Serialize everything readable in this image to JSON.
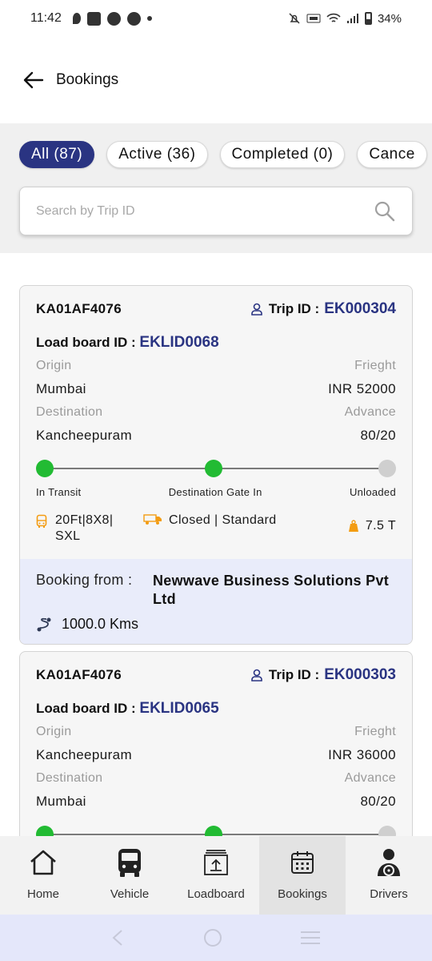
{
  "status_bar": {
    "time": "11:42",
    "battery": "34%"
  },
  "header": {
    "title": "Bookings"
  },
  "tabs": [
    {
      "label": "All (87)",
      "active": true
    },
    {
      "label": "Active (36)",
      "active": false
    },
    {
      "label": "Completed (0)",
      "active": false
    },
    {
      "label": "Cance",
      "active": false
    }
  ],
  "search": {
    "placeholder": "Search by Trip ID",
    "value": ""
  },
  "bookings": [
    {
      "vehicle_no": "KA01AF4076",
      "trip_label": "Trip ID :",
      "trip_id": "EK000304",
      "load_label": "Load board ID :",
      "load_id": "EKLID0068",
      "origin_label": "Origin",
      "origin": "Mumbai",
      "freight_label": "Frieght",
      "freight": "INR 52000",
      "destination_label": "Destination",
      "destination": "Kancheepuram",
      "advance_label": "Advance",
      "advance": "80/20",
      "steps": [
        "In Transit",
        "Destination Gate In",
        "Unloaded"
      ],
      "truck_size_1": "20Ft|8X8|",
      "truck_size_2": "SXL",
      "body_type": "Closed | Standard",
      "capacity": "7.5 T",
      "booking_from_label": "Booking from :",
      "booking_from_1": "Newwave Business Solutions Pvt",
      "booking_from_2": "Ltd",
      "distance": "1000.0 Kms"
    },
    {
      "vehicle_no": "KA01AF4076",
      "trip_label": "Trip ID :",
      "trip_id": "EK000303",
      "load_label": "Load board ID :",
      "load_id": "EKLID0065",
      "origin_label": "Origin",
      "origin": "Kancheepuram",
      "freight_label": "Frieght",
      "freight": "INR 36000",
      "destination_label": "Destination",
      "destination": "Mumbai",
      "advance_label": "Advance",
      "advance": "80/20"
    }
  ],
  "bottom_nav": [
    {
      "label": "Home",
      "icon": "home-icon"
    },
    {
      "label": "Vehicle",
      "icon": "bus-icon"
    },
    {
      "label": "Loadboard",
      "icon": "upload-icon"
    },
    {
      "label": "Bookings",
      "icon": "calendar-icon",
      "active": true
    },
    {
      "label": "Drivers",
      "icon": "driver-icon"
    }
  ],
  "colors": {
    "primary": "#2a3482",
    "done": "#22bb33",
    "pending": "#cfcfcf",
    "accent": "#f39c12"
  }
}
